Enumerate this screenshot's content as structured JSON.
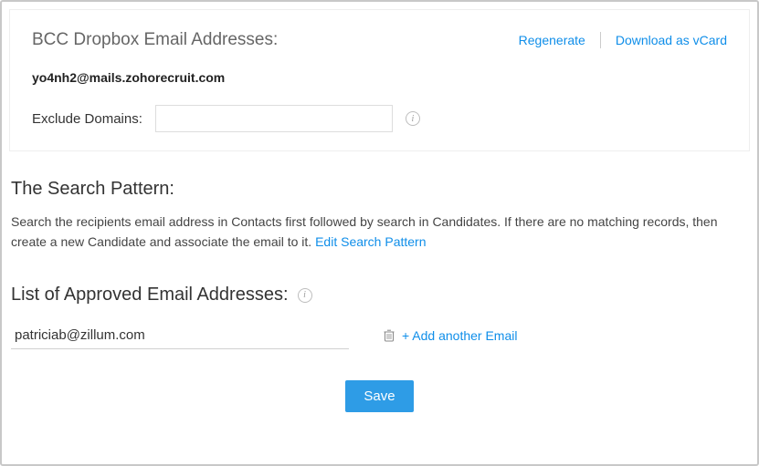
{
  "bcc": {
    "title": "BCC Dropbox Email Addresses:",
    "regenerate": "Regenerate",
    "download_vcard": "Download as vCard",
    "email": "yo4nh2@mails.zohorecruit.com",
    "exclude_label": "Exclude Domains:",
    "exclude_value": ""
  },
  "search": {
    "title": "The Search Pattern:",
    "description": "Search the recipients email address in Contacts first followed by search in Candidates. If there are no matching records, then create a new Candidate and associate the email to it. ",
    "edit_link": "Edit Search Pattern"
  },
  "approved": {
    "title": "List of Approved Email Addresses:",
    "emails": [
      "patriciab@zillum.com"
    ],
    "add_label": "+ Add another Email"
  },
  "actions": {
    "save": "Save"
  }
}
